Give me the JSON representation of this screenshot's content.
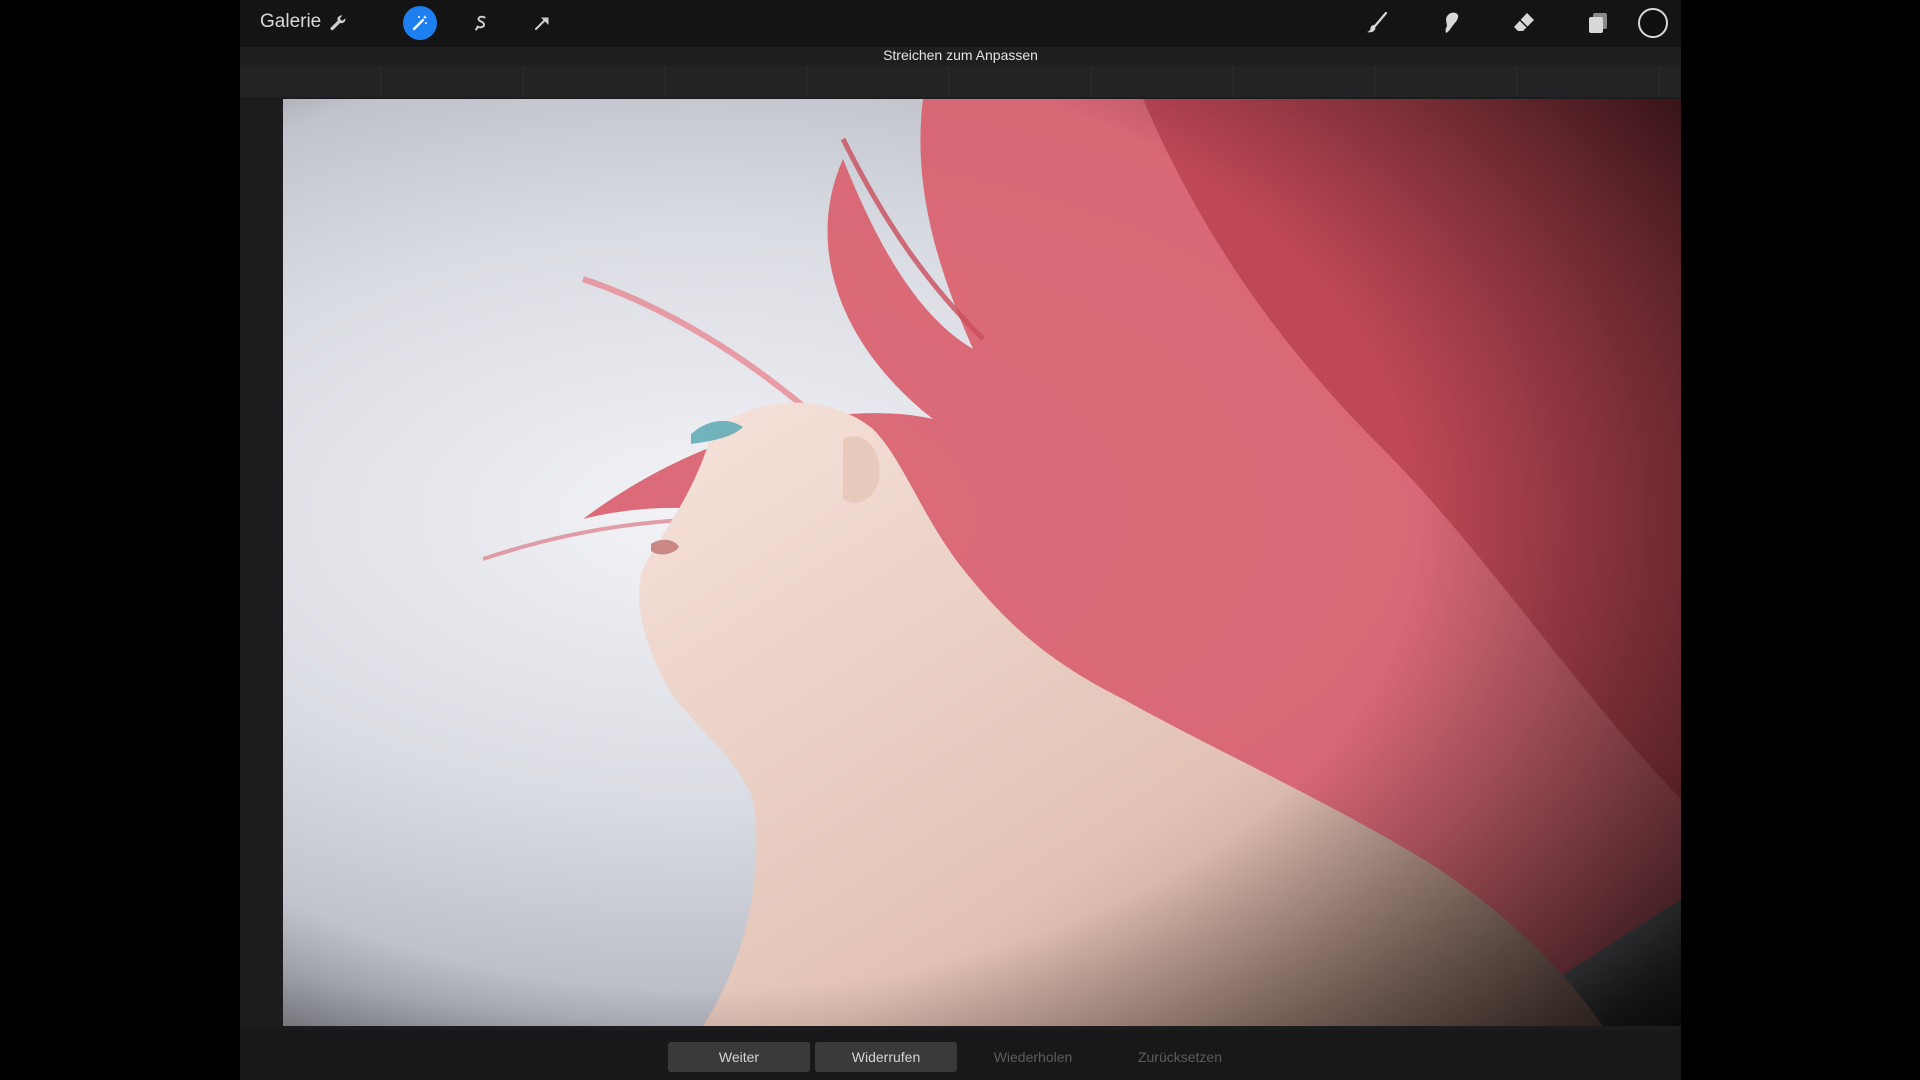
{
  "toolbar": {
    "gallery_label": "Galerie",
    "left_tools": [
      {
        "name": "wrench-icon",
        "active": false
      },
      {
        "name": "magic-wand-icon",
        "active": true
      },
      {
        "name": "selection-icon",
        "active": false
      },
      {
        "name": "transform-arrow-icon",
        "active": false
      }
    ],
    "right_tools": [
      {
        "name": "brush-icon"
      },
      {
        "name": "smudge-icon"
      },
      {
        "name": "eraser-icon"
      },
      {
        "name": "layers-icon"
      }
    ],
    "current_color": "#101012",
    "accent_color": "#1e7ff0"
  },
  "adjustment": {
    "hint": "Streichen zum Anpassen"
  },
  "bottom_actions": {
    "weiter": "Weiter",
    "widerrufen": "Widerrufen",
    "wiederholen": "Wiederholen",
    "zuruecksetzen": "Zurücksetzen"
  }
}
